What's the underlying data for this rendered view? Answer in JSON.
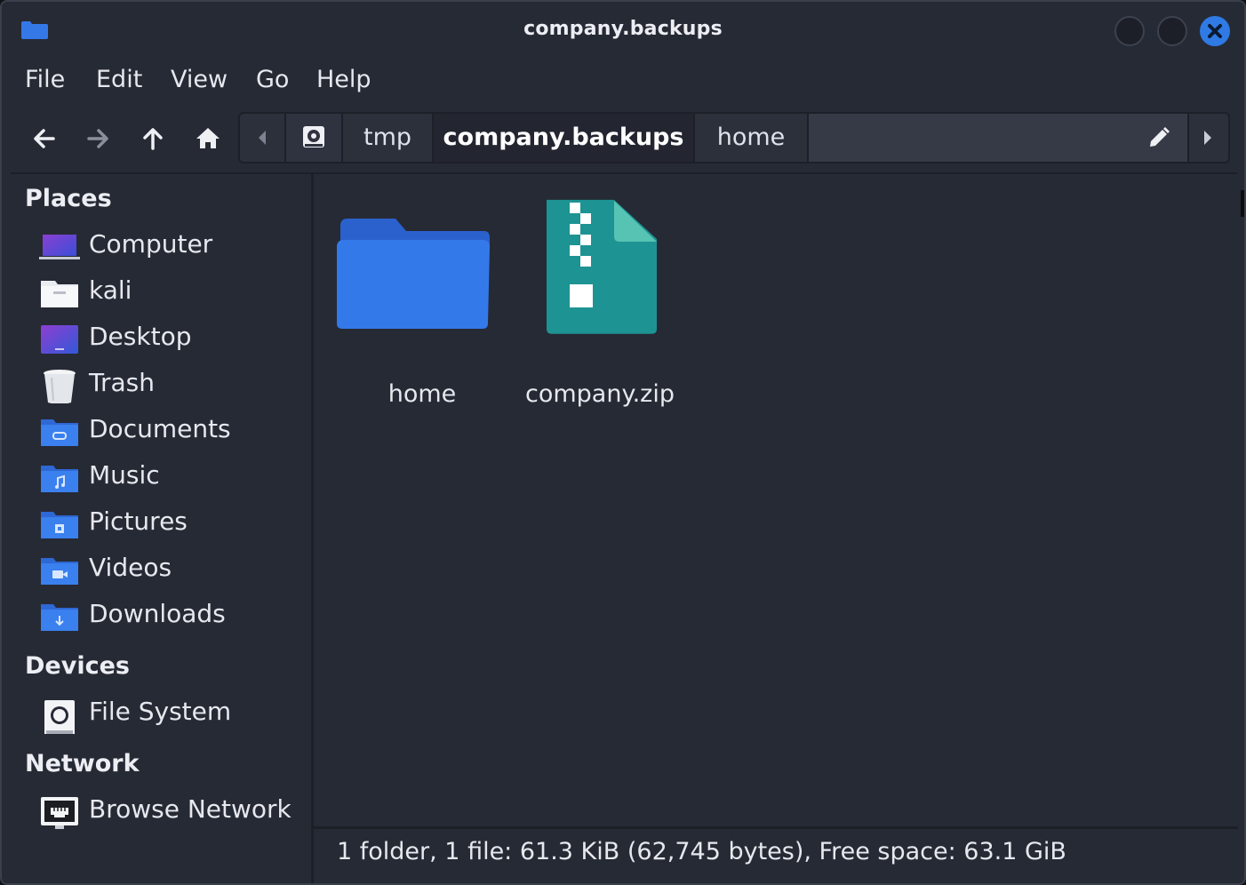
{
  "window": {
    "title": "company.backups"
  },
  "menu": {
    "items": [
      "File",
      "Edit",
      "View",
      "Go",
      "Help"
    ]
  },
  "toolbar": {
    "back_icon": "arrow-left-icon",
    "forward_icon": "arrow-right-icon",
    "up_icon": "arrow-up-icon",
    "home_icon": "home-icon"
  },
  "pathbar": {
    "segments": [
      "tmp",
      "company.backups",
      "home"
    ],
    "active_index": 1,
    "edit_icon": "pencil-icon"
  },
  "sidebar": {
    "places_title": "Places",
    "places": [
      {
        "label": "Computer",
        "icon": "computer-icon"
      },
      {
        "label": "kali",
        "icon": "home-folder-icon"
      },
      {
        "label": "Desktop",
        "icon": "desktop-icon"
      },
      {
        "label": "Trash",
        "icon": "trash-icon"
      },
      {
        "label": "Documents",
        "icon": "documents-folder-icon"
      },
      {
        "label": "Music",
        "icon": "music-folder-icon"
      },
      {
        "label": "Pictures",
        "icon": "pictures-folder-icon"
      },
      {
        "label": "Videos",
        "icon": "videos-folder-icon"
      },
      {
        "label": "Downloads",
        "icon": "downloads-folder-icon"
      }
    ],
    "devices_title": "Devices",
    "devices": [
      {
        "label": "File System",
        "icon": "drive-icon"
      }
    ],
    "network_title": "Network",
    "network": [
      {
        "label": "Browse Network",
        "icon": "network-icon"
      }
    ]
  },
  "files": [
    {
      "name": "home",
      "icon": "folder-icon"
    },
    {
      "name": "company.zip",
      "icon": "zip-archive-icon"
    }
  ],
  "status": {
    "text": "1 folder, 1 file: 61.3 KiB (62,745 bytes), Free space: 63.1 GiB"
  },
  "colors": {
    "background": "#262a35",
    "accent": "#2f7ae5",
    "folder": "#3478e8",
    "archive": "#1f9393"
  }
}
